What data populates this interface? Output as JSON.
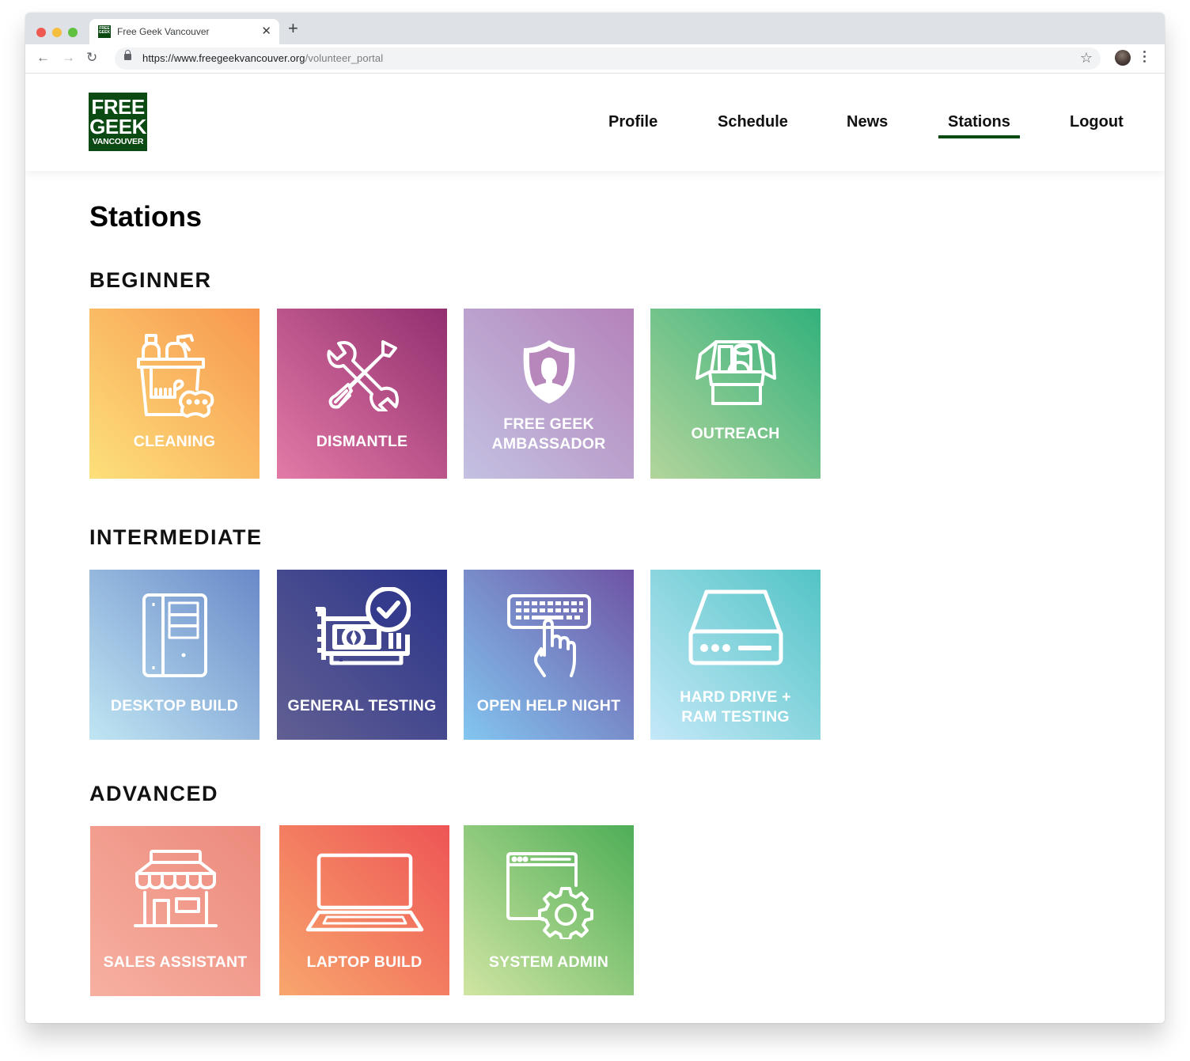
{
  "browser": {
    "tab_title": "Free Geek Vancouver",
    "url_host": "https://www.freegeekvancouver.org",
    "url_path": "/volunteer_portal",
    "favicon_text": "FREE GEEK"
  },
  "site": {
    "logo": {
      "line1": "FREE",
      "line2": "GEEK",
      "line3": "VANCOUVER"
    },
    "nav": [
      {
        "label": "Profile",
        "active": false
      },
      {
        "label": "Schedule",
        "active": false
      },
      {
        "label": "News",
        "active": false
      },
      {
        "label": "Stations",
        "active": true
      },
      {
        "label": "Logout",
        "active": false
      }
    ],
    "accent_color": "#0b4a12"
  },
  "page": {
    "title": "Stations",
    "sections": [
      {
        "title": "BEGINNER",
        "stations": [
          {
            "label": "CLEANING",
            "icon": "cleaning-supplies-icon",
            "gradient": [
              "#fde07a",
              "#f7964f"
            ]
          },
          {
            "label": "DISMANTLE",
            "icon": "wrench-screwdriver-icon",
            "gradient": [
              "#e37aa6",
              "#922f6f"
            ]
          },
          {
            "label": "FREE GEEK AMBASSADOR",
            "label_lines": [
              "FREE GEEK",
              "AMBASSADOR"
            ],
            "icon": "shield-person-icon",
            "gradient": [
              "#c3c1e2",
              "#b482b9"
            ]
          },
          {
            "label": "OUTREACH",
            "icon": "open-box-icon",
            "gradient": [
              "#b2d59b",
              "#33b17c"
            ]
          }
        ]
      },
      {
        "title": "INTERMEDIATE",
        "stations": [
          {
            "label": "DESKTOP BUILD",
            "icon": "desktop-tower-icon",
            "gradient": [
              "#c0e6f3",
              "#6889c8"
            ]
          },
          {
            "label": "GENERAL TESTING",
            "icon": "graphics-card-check-icon",
            "gradient": [
              "#615f93",
              "#2a3389"
            ]
          },
          {
            "label": "OPEN HELP NIGHT",
            "icon": "keyboard-hand-icon",
            "gradient": [
              "#83c6f0",
              "#6e53a4"
            ]
          },
          {
            "label": "HARD DRIVE + RAM TESTING",
            "label_lines": [
              "HARD DRIVE +",
              "RAM TESTING"
            ],
            "icon": "hard-drive-icon",
            "gradient": [
              "#c4e8f8",
              "#52c4c6"
            ]
          }
        ]
      },
      {
        "title": "ADVANCED",
        "stations": [
          {
            "label": "SALES ASSISTANT",
            "icon": "storefront-icon",
            "gradient": [
              "#f7b0a0",
              "#ec8a7c"
            ]
          },
          {
            "label": "LAPTOP BUILD",
            "icon": "laptop-icon",
            "gradient": [
              "#f8a66d",
              "#ee5555"
            ]
          },
          {
            "label": "SYSTEM ADMIN",
            "icon": "browser-gear-icon",
            "gradient": [
              "#d0e5a2",
              "#4eae57"
            ]
          }
        ]
      }
    ]
  }
}
